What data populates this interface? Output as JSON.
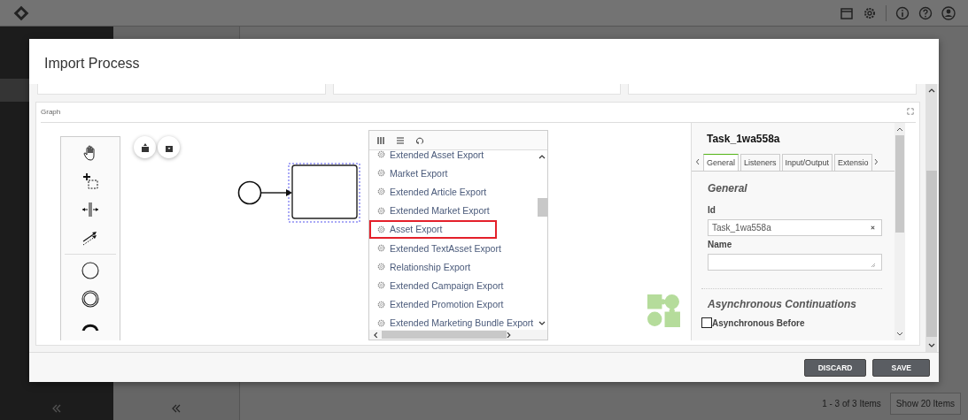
{
  "window": {
    "title": "Import Process"
  },
  "graph": {
    "label": "Graph",
    "popup_menu": {
      "items": [
        {
          "label": "Extended Asset Export",
          "highlighted": false
        },
        {
          "label": "Market Export",
          "highlighted": false
        },
        {
          "label": "Extended Article Export",
          "highlighted": false
        },
        {
          "label": "Extended Market Export",
          "highlighted": false
        },
        {
          "label": "Asset Export",
          "highlighted": true
        },
        {
          "label": "Extended TextAsset Export",
          "highlighted": false
        },
        {
          "label": "Relationship Export",
          "highlighted": false
        },
        {
          "label": "Extended Campaign Export",
          "highlighted": false
        },
        {
          "label": "Extended Promotion Export",
          "highlighted": false
        },
        {
          "label": "Extended Marketing Bundle Export",
          "highlighted": false
        }
      ]
    }
  },
  "properties": {
    "title": "Task_1wa558a",
    "tabs": [
      {
        "label": "General",
        "selected": true
      },
      {
        "label": "Listeners",
        "selected": false
      },
      {
        "label": "Input/Output",
        "selected": false
      },
      {
        "label": "Extensio",
        "selected": false
      }
    ],
    "section": "General",
    "fields": [
      {
        "kind": "text",
        "label": "Id",
        "value": "Task_1wa558a"
      },
      {
        "kind": "textarea",
        "label": "Name"
      }
    ],
    "async_section": "Asynchronous Continuations",
    "checkbox": {
      "label": "Asynchronous Before",
      "checked": false
    }
  },
  "buttons": [
    {
      "label": "DISCARD"
    },
    {
      "label": "SAVE"
    }
  ],
  "pager": {
    "range": "1 - 3 of 3 Items",
    "page_size": "Show 20 Items"
  }
}
